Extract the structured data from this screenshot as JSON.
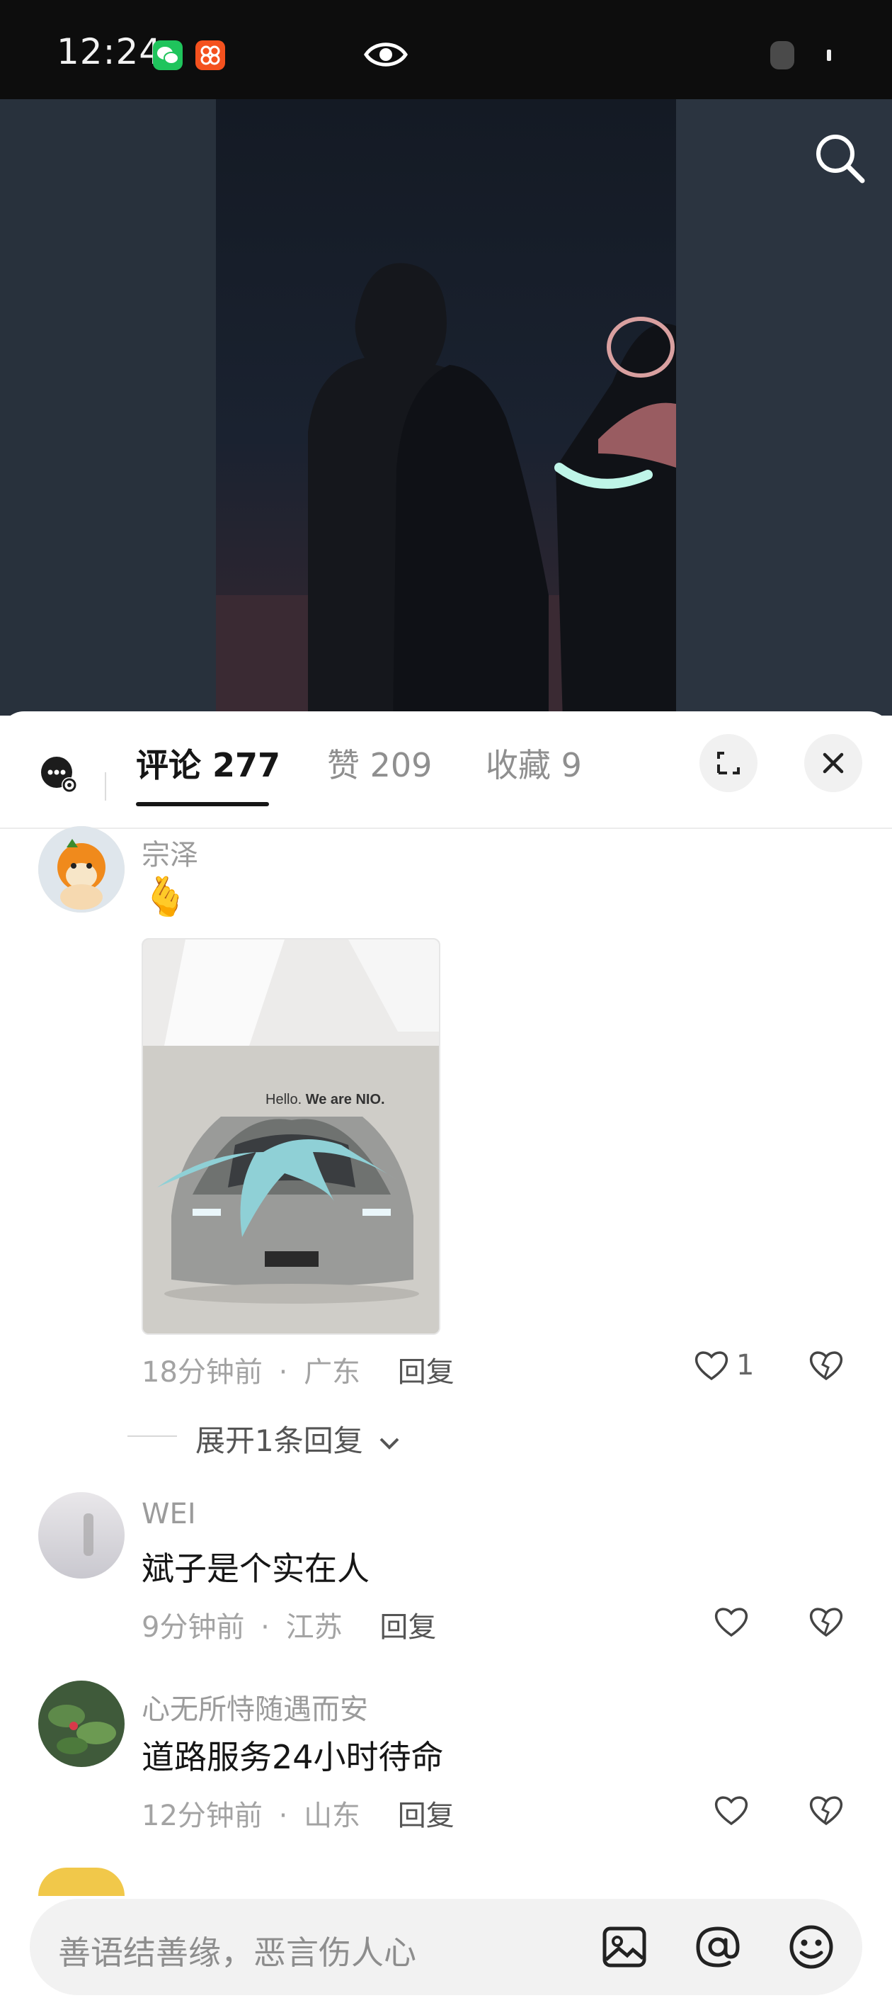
{
  "status_bar": {
    "time": "12:24",
    "icons": [
      "wechat-icon",
      "app-badge-icon",
      "eye-icon"
    ]
  },
  "video": {
    "search_icon": "search-icon"
  },
  "sheet": {
    "tabs": [
      {
        "label": "评论 277",
        "active": true
      },
      {
        "label": "赞 209",
        "active": false
      },
      {
        "label": "收藏 9",
        "active": false
      }
    ],
    "expand_icon": "expand-icon",
    "close_icon": "close-icon"
  },
  "comments": [
    {
      "username": "宗泽",
      "text": "🫰",
      "image_caption": "Hello. We are NIO.",
      "time": "18分钟前",
      "location": "广东",
      "reply_label": "回复",
      "likes": "1"
    },
    {
      "username": "WEI",
      "text": "斌子是个实在人",
      "time": "9分钟前",
      "location": "江苏",
      "reply_label": "回复",
      "likes": ""
    },
    {
      "username": "心无所恃随遇而安",
      "text": "道路服务24小时待命",
      "time": "12分钟前",
      "location": "山东",
      "reply_label": "回复",
      "likes": ""
    }
  ],
  "expand_replies": "展开1条回复",
  "meta_separator": "·",
  "input": {
    "placeholder": "善语结善缘，恶言伤人心"
  },
  "colors": {
    "status_bar": "#0d0d0d",
    "sheet_bg": "#ffffff",
    "text_primary": "#161616",
    "text_secondary": "#9b9b9b"
  }
}
